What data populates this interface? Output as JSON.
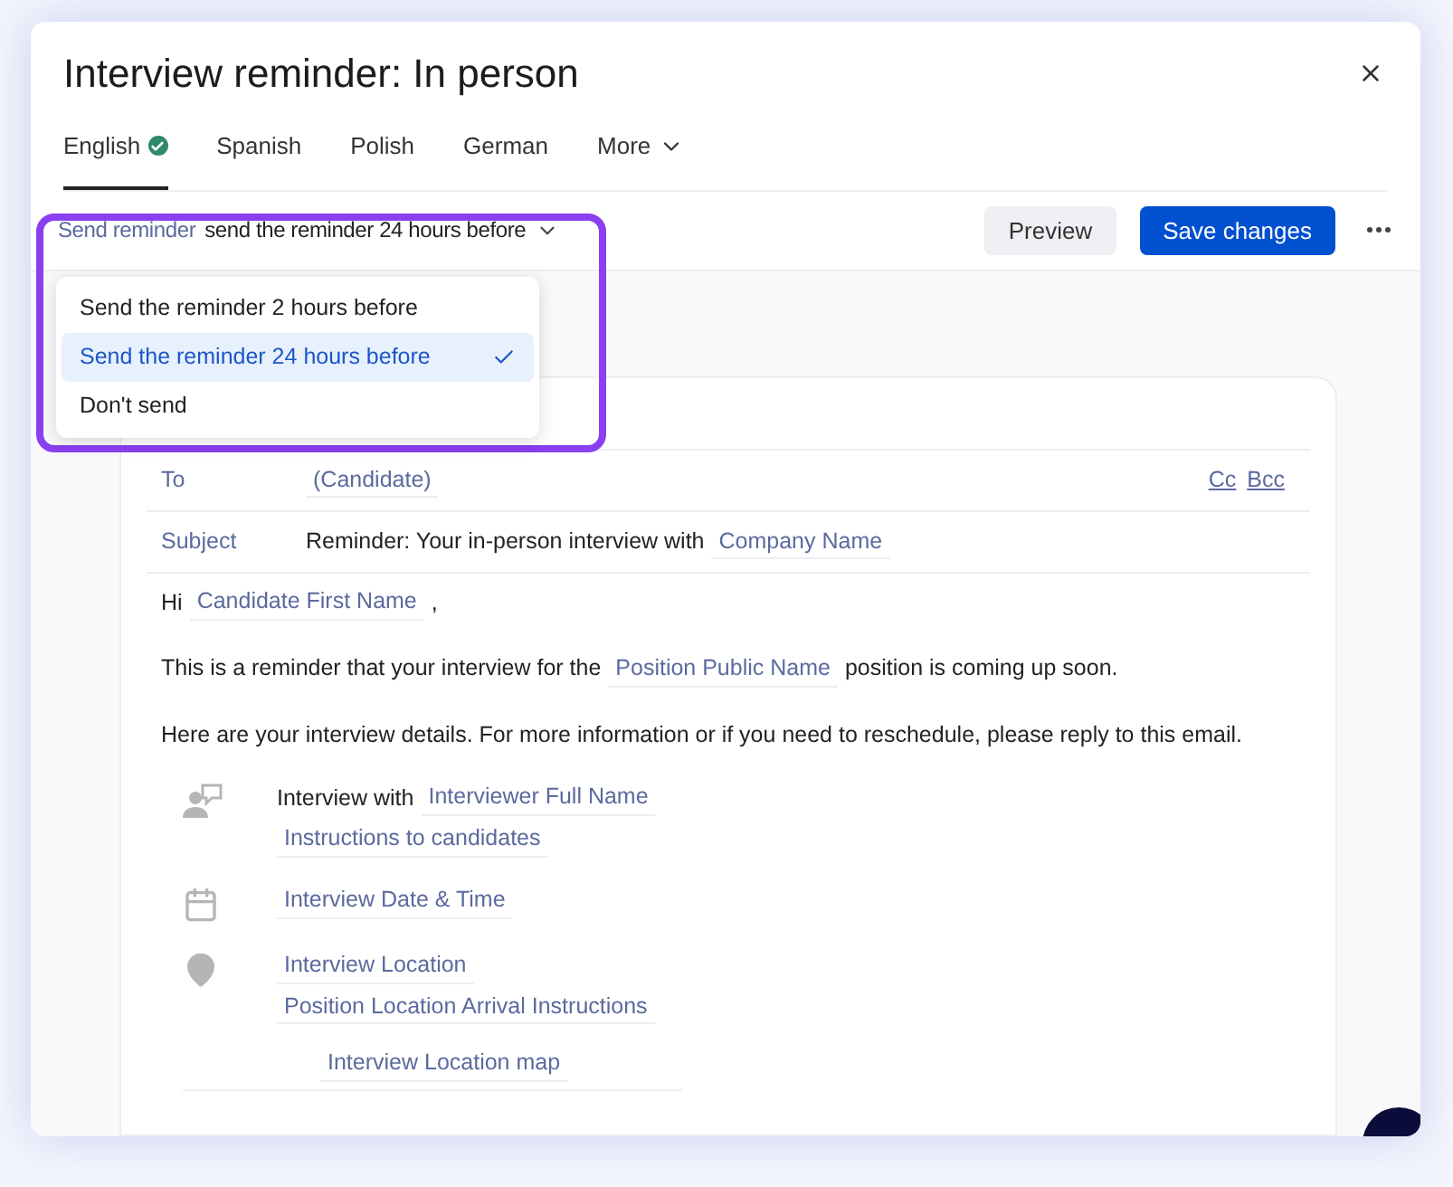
{
  "dialog": {
    "title": "Interview reminder: In person"
  },
  "tabs": [
    {
      "label": "English",
      "selected": true,
      "verified": true,
      "kind": "tab"
    },
    {
      "label": "Spanish",
      "selected": false,
      "verified": false,
      "kind": "tab"
    },
    {
      "label": "Polish",
      "selected": false,
      "verified": false,
      "kind": "tab"
    },
    {
      "label": "German",
      "selected": false,
      "verified": false,
      "kind": "tab"
    },
    {
      "label": "More",
      "selected": false,
      "verified": false,
      "kind": "menu"
    }
  ],
  "reminder": {
    "label": "Send reminder",
    "value": "send the reminder 24 hours before",
    "expanded": true,
    "options": [
      {
        "label": "Send the reminder 2 hours before",
        "selected": false
      },
      {
        "label": "Send the reminder 24 hours before",
        "selected": true
      },
      {
        "label": "Don't send",
        "selected": false
      }
    ]
  },
  "buttons": [
    {
      "label": "Preview",
      "kind": "secondary"
    },
    {
      "label": "Save changes",
      "kind": "primary"
    }
  ],
  "email": {
    "fields": [
      {
        "label": "To",
        "segments": [
          {
            "kind": "token",
            "text": "(Candidate)"
          }
        ],
        "links": [
          "Cc",
          "Bcc"
        ]
      },
      {
        "label": "Subject",
        "segments": [
          {
            "kind": "text",
            "text": "Reminder: Your in-person interview with"
          },
          {
            "kind": "token",
            "text": "Company Name"
          }
        ]
      }
    ],
    "paragraphs": [
      [
        {
          "kind": "text",
          "text": "Hi"
        },
        {
          "kind": "token",
          "text": "Candidate First Name"
        },
        {
          "kind": "text",
          "text": ","
        }
      ],
      [
        {
          "kind": "text",
          "text": "This is a reminder that your interview for the"
        },
        {
          "kind": "token",
          "text": "Position Public Name"
        },
        {
          "kind": "text",
          "text": "position is coming up soon."
        }
      ],
      [
        {
          "kind": "text",
          "text": "Here are your interview details. For more information or if you need to reschedule, please reply to this email."
        }
      ]
    ],
    "details": [
      {
        "kind": "contact",
        "lines": [
          [
            {
              "kind": "text",
              "text": "Interview with"
            },
            {
              "kind": "token",
              "text": "Interviewer Full Name"
            }
          ],
          [
            {
              "kind": "token",
              "text": "Instructions to candidates"
            }
          ]
        ]
      },
      {
        "kind": "date",
        "lines": [
          [
            {
              "kind": "token",
              "text": "Interview Date & Time"
            }
          ]
        ]
      },
      {
        "kind": "place",
        "lines": [
          [
            {
              "kind": "token",
              "text": "Interview Location"
            }
          ],
          [
            {
              "kind": "token",
              "text": "Position Location Arrival Instructions"
            }
          ]
        ]
      },
      {
        "kind": "map",
        "lines": [
          [
            {
              "kind": "token",
              "text": "Interview Location map"
            }
          ]
        ]
      }
    ]
  }
}
